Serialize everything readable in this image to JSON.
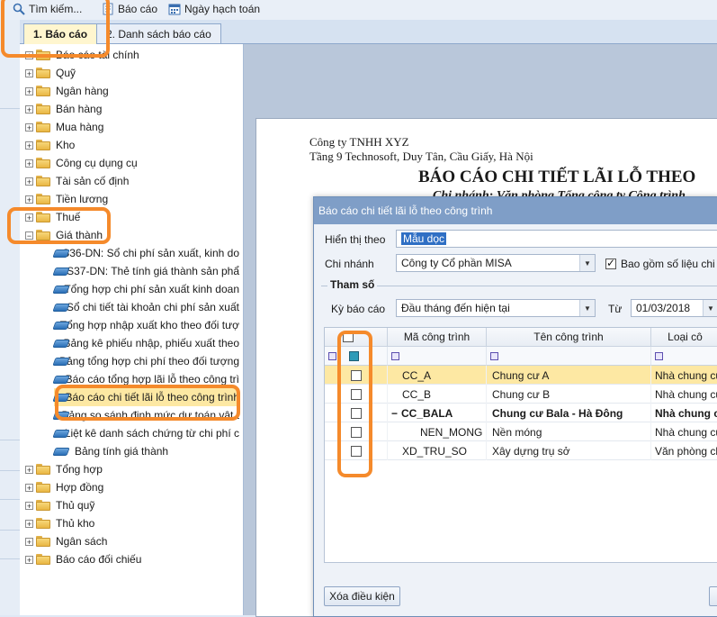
{
  "toolbar": {
    "search_label": "Tìm kiếm...",
    "report_label": "Báo cáo",
    "accounting_date_label": "Ngày hạch toán"
  },
  "tabs": [
    {
      "label": "1. Báo cáo",
      "active": true
    },
    {
      "label": "2. Danh sách báo cáo",
      "active": false
    }
  ],
  "tree": {
    "items": [
      {
        "label": "Báo cáo tài chính",
        "type": "folder",
        "expander": "+"
      },
      {
        "label": "Quỹ",
        "type": "folder",
        "expander": "+"
      },
      {
        "label": "Ngân hàng",
        "type": "folder",
        "expander": "+"
      },
      {
        "label": "Bán hàng",
        "type": "folder",
        "expander": "+"
      },
      {
        "label": "Mua hàng",
        "type": "folder",
        "expander": "+"
      },
      {
        "label": "Kho",
        "type": "folder",
        "expander": "+"
      },
      {
        "label": "Công cụ dụng cụ",
        "type": "folder",
        "expander": "+"
      },
      {
        "label": "Tài sản cố định",
        "type": "folder",
        "expander": "+"
      },
      {
        "label": "Tiền lương",
        "type": "folder",
        "expander": "+"
      },
      {
        "label": "Thuế",
        "type": "folder",
        "expander": "+"
      },
      {
        "label": "Giá thành",
        "type": "folder",
        "expander": "−"
      },
      {
        "label": "S36-DN: Sổ chi phí sản xuất, kinh do",
        "type": "report"
      },
      {
        "label": "S37-DN: Thẻ tính giá thành sản phẩ",
        "type": "report"
      },
      {
        "label": "Tổng hợp chi phí sản xuất kinh doan",
        "type": "report"
      },
      {
        "label": "Sổ chi tiết tài khoản chi phí sản xuất",
        "type": "report"
      },
      {
        "label": "Tổng hợp nhập xuất kho theo đối tượ",
        "type": "report"
      },
      {
        "label": "Bảng kê phiếu nhập, phiếu xuất theo",
        "type": "report"
      },
      {
        "label": "Bảng tổng hợp chi phí theo đối tượng",
        "type": "report"
      },
      {
        "label": "Báo cáo tổng hợp lãi lỗ theo công trì",
        "type": "report"
      },
      {
        "label": "Báo cáo chi tiết lãi lỗ theo công trình",
        "type": "report",
        "selected": true
      },
      {
        "label": "Bảng so sánh định mức dự toán vật t",
        "type": "report"
      },
      {
        "label": "Liệt kê danh sách chứng từ chi phí c",
        "type": "report"
      },
      {
        "label": "Bảng tính giá thành",
        "type": "report"
      },
      {
        "label": "Tổng hợp",
        "type": "folder",
        "expander": "+"
      },
      {
        "label": "Hợp đồng",
        "type": "folder",
        "expander": "+"
      },
      {
        "label": "Thủ quỹ",
        "type": "folder",
        "expander": "+"
      },
      {
        "label": "Thủ kho",
        "type": "folder",
        "expander": "+"
      },
      {
        "label": "Ngân sách",
        "type": "folder",
        "expander": "+"
      },
      {
        "label": "Báo cáo đối chiếu",
        "type": "folder",
        "expander": "+"
      }
    ]
  },
  "paper": {
    "company": "Công ty TNHH XYZ",
    "address": "Tầng 9 Technosoft, Duy Tân, Cầu Giấy, Hà Nội",
    "title": "BÁO CÁO CHI TIẾT LÃI LỖ THEO",
    "branch_line": "Chi nhánh: Văn phòng Tổng công ty Công trình"
  },
  "dialog": {
    "title": "Báo cáo chi tiết lãi lỗ theo công trình",
    "display_label": "Hiển thị theo",
    "display_value": "Mẫu dọc",
    "branch_label": "Chi nhánh",
    "branch_value": "Công ty Cổ phần MISA",
    "include_label": "Bao gồm số liệu chi nh",
    "include_checked": true,
    "params_legend": "Tham số",
    "period_label": "Kỳ báo cáo",
    "period_value": "Đầu tháng đến hiện tại",
    "from_label": "Từ",
    "from_value": "01/03/2018",
    "clear_button": "Xóa điều kiện",
    "grid": {
      "columns": [
        "Mã công trình",
        "Tên công trình",
        "Loại cô"
      ],
      "rows": [
        {
          "code": "CC_A",
          "name": "Chung cư A",
          "type": "Nhà chung cư",
          "checked": false,
          "highlight": true,
          "bold": false,
          "indent": 1
        },
        {
          "code": "CC_B",
          "name": "Chung cư B",
          "type": "Nhà chung cư",
          "checked": false,
          "highlight": false,
          "bold": false,
          "indent": 1
        },
        {
          "code": "CC_BALA",
          "name": "Chung cư Bala - Hà Đông",
          "type": "Nhà chung cư",
          "checked": false,
          "highlight": false,
          "bold": true,
          "indent": 0,
          "expander": "−"
        },
        {
          "code": "NEN_MONG",
          "name": "Nền móng",
          "type": "Nhà chung cư",
          "checked": false,
          "highlight": false,
          "bold": false,
          "indent": 2
        },
        {
          "code": "XD_TRU_SO",
          "name": "Xây dựng trụ sở",
          "type": "Văn phòng cho",
          "checked": false,
          "highlight": false,
          "bold": false,
          "indent": 1
        }
      ]
    }
  }
}
